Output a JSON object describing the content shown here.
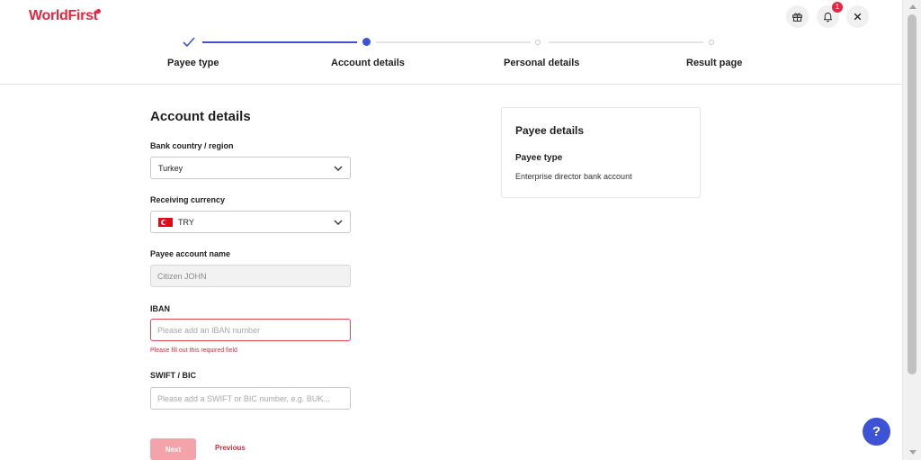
{
  "brand": {
    "logo_text": "WorldFirst",
    "accent_color": "#e3283f"
  },
  "header": {
    "notification_count": "1",
    "icons": [
      "gift-icon",
      "bell-icon",
      "close-icon"
    ]
  },
  "stepper": {
    "steps": [
      {
        "label": "Payee type",
        "state": "complete"
      },
      {
        "label": "Account details",
        "state": "current"
      },
      {
        "label": "Personal details",
        "state": "upcoming"
      },
      {
        "label": "Result page",
        "state": "upcoming"
      }
    ],
    "active_color": "#3d52d5"
  },
  "form": {
    "title": "Account details",
    "bank_country": {
      "label": "Bank country / region",
      "value": "Turkey"
    },
    "currency": {
      "label": "Receiving currency",
      "value": "TRY"
    },
    "account_name": {
      "label": "Payee account name",
      "value": "Citizen JOHN"
    },
    "iban": {
      "label": "IBAN",
      "placeholder": "Please add an IBAN number",
      "error": "Please fill out this required field"
    },
    "swift": {
      "label": "SWIFT / BIC",
      "placeholder": "Please add a SWIFT or BIC number, e.g. BUK..."
    },
    "next_label": "Next",
    "previous_label": "Previous"
  },
  "payee_card": {
    "title": "Payee details",
    "type_label": "Payee type",
    "type_value": "Enterprise director bank account"
  },
  "help": {
    "label": "?"
  }
}
